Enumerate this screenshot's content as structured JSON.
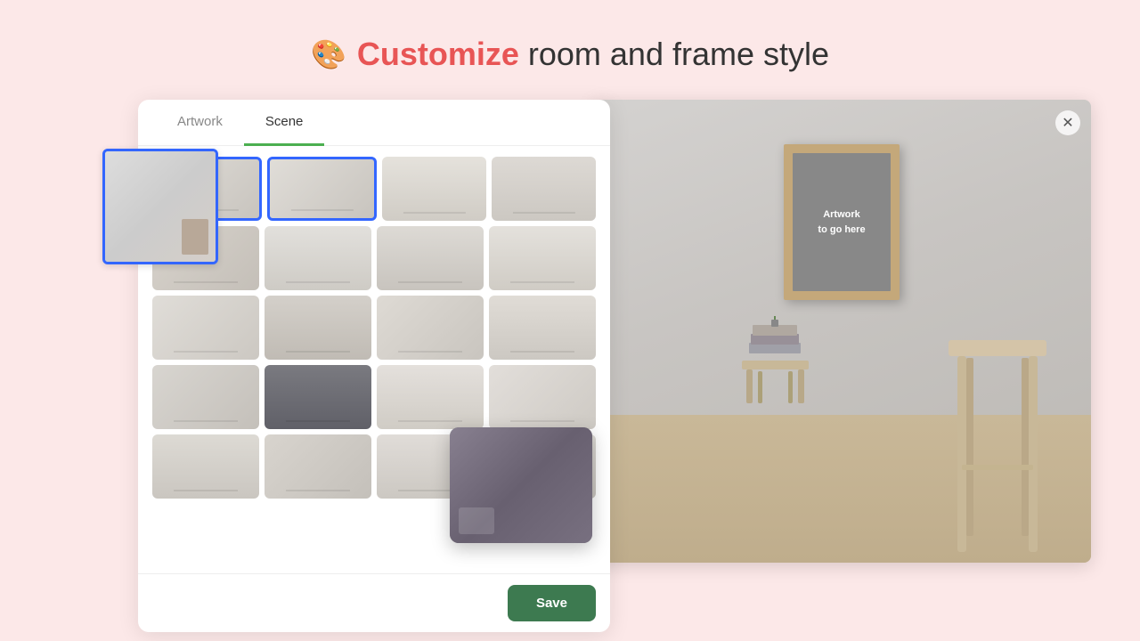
{
  "header": {
    "icon": "🎨",
    "title_highlight": "Customize",
    "title_rest": " room and frame style"
  },
  "tabs": [
    {
      "id": "artwork",
      "label": "Artwork",
      "active": false
    },
    {
      "id": "scene",
      "label": "Scene",
      "active": true
    }
  ],
  "grid": {
    "rows": [
      [
        "scene-1 selected",
        "scene-2 selected",
        "scene-3",
        "scene-4"
      ],
      [
        "scene-5",
        "scene-6",
        "scene-7",
        "scene-8"
      ],
      [
        "scene-9",
        "scene-10",
        "scene-11",
        "scene-12"
      ],
      [
        "scene-13",
        "scene-14",
        "scene-15",
        "scene-16"
      ],
      [
        "scene-17",
        "scene-18",
        "scene-19",
        "scene-20"
      ]
    ]
  },
  "save_button": "Save",
  "room_preview": {
    "artwork_placeholder": "Artwork\nto go here",
    "close_icon": "✕"
  },
  "selected_large_thumb": {
    "scene_class": "scene-1"
  }
}
